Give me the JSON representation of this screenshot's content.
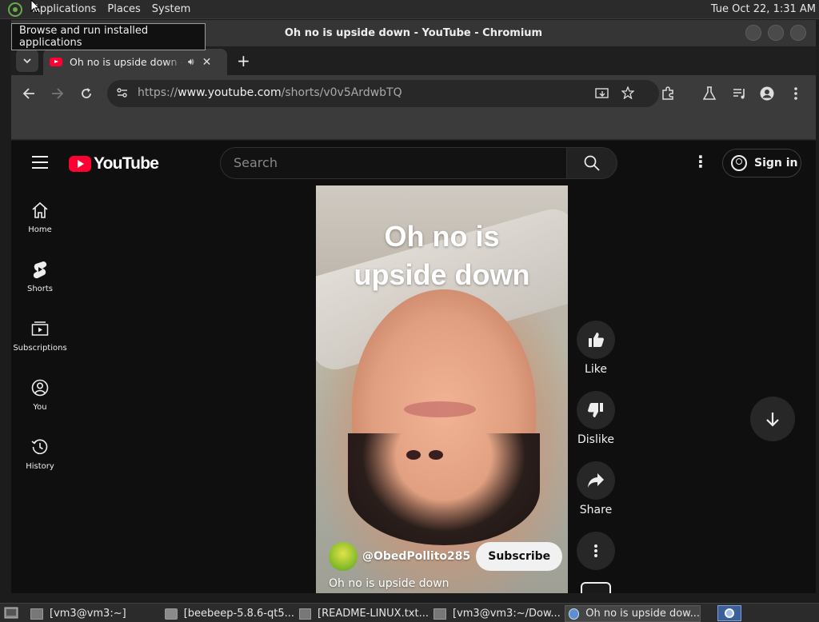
{
  "panel": {
    "menus": [
      "Applications",
      "Places",
      "System"
    ],
    "clock": "Tue Oct 22,  1:31 AM",
    "tooltip": "Browse and run installed applications"
  },
  "window": {
    "title": "Oh no is upside down - YouTube - Chromium"
  },
  "tabs": [
    {
      "title": "Oh no is upside down - YouTube",
      "favicon": "youtube-icon",
      "audio": true
    }
  ],
  "toolbar": {
    "url_scheme": "https://",
    "url_host": "www.youtube.com",
    "url_path": "/shorts/v0v5ArdwbTQ"
  },
  "youtube": {
    "logo_text": "YouTube",
    "search": {
      "placeholder": "Search"
    },
    "signin_label": "Sign in",
    "sidebar": [
      {
        "label": "Home",
        "icon": "home-icon"
      },
      {
        "label": "Shorts",
        "icon": "shorts-icon"
      },
      {
        "label": "Subscriptions",
        "icon": "subscriptions-icon"
      },
      {
        "label": "You",
        "icon": "you-icon"
      },
      {
        "label": "History",
        "icon": "history-icon"
      }
    ],
    "video": {
      "overlay_title": "Oh no is upside down",
      "channel": "@ObedPollito285",
      "subscribe_label": "Subscribe",
      "caption": "Oh no is upside down"
    },
    "actions": [
      {
        "label": "Like",
        "icon": "thumb-up-icon"
      },
      {
        "label": "Dislike",
        "icon": "thumb-down-icon"
      },
      {
        "label": "Share",
        "icon": "share-icon"
      }
    ]
  },
  "taskbar": [
    {
      "label": "[vm3@vm3:~]",
      "icon": "terminal-icon"
    },
    {
      "label": "[beebeep-5.8.6-qt5...",
      "icon": "folder-icon"
    },
    {
      "label": "[README-LINUX.txt...",
      "icon": "text-editor-icon"
    },
    {
      "label": "[vm3@vm3:~/Dow...",
      "icon": "terminal-icon"
    },
    {
      "label": "Oh no is upside dow...",
      "icon": "chromium-icon",
      "active": true
    }
  ]
}
